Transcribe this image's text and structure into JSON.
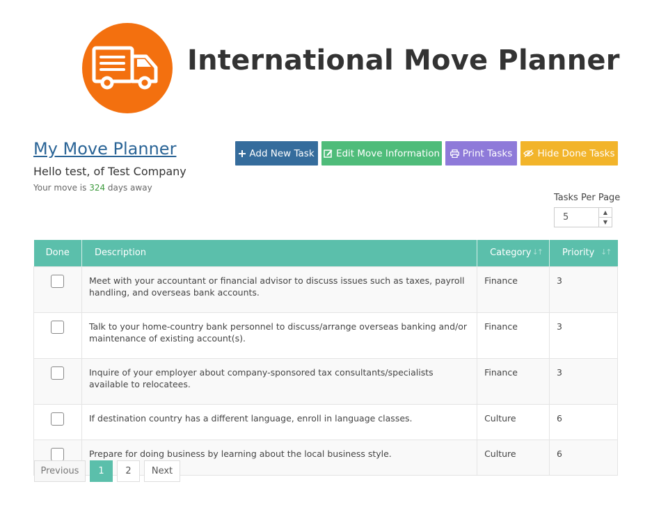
{
  "header": {
    "logo_icon": "truck-icon",
    "logo_color": "#f3700f",
    "title": "International Move Planner"
  },
  "planner": {
    "title": "My Move Planner",
    "greeting": "Hello test, of Test Company",
    "countdown_prefix": "Your move is",
    "days": "324",
    "countdown_suffix": "days away"
  },
  "toolbar": {
    "add_label": "Add New Task",
    "edit_label": "Edit Move Information",
    "print_label": "Print Tasks",
    "hide_label": "Hide Done Tasks",
    "colors": {
      "add": "#356c9c",
      "edit": "#4fbc7a",
      "print": "#8e7ad9",
      "hide": "#f2b42a"
    }
  },
  "pagination_settings": {
    "label": "Tasks Per Page",
    "value": "5"
  },
  "table": {
    "header_color": "#5bbfab",
    "columns": [
      "Done",
      "Description",
      "Category",
      "Priority"
    ],
    "rows": [
      {
        "done": false,
        "description": "Meet with your accountant or financial advisor to discuss issues such as taxes, payroll handling, and overseas bank accounts.",
        "category": "Finance",
        "priority": "3"
      },
      {
        "done": false,
        "description": "Talk to your home-country bank personnel to discuss/arrange overseas banking and/or maintenance of existing account(s).",
        "category": "Finance",
        "priority": "3"
      },
      {
        "done": false,
        "description": "Inquire of your employer about company-sponsored tax consultants/specialists available to relocatees.",
        "category": "Finance",
        "priority": "3"
      },
      {
        "done": false,
        "description": "If destination country has a different language, enroll in language classes.",
        "category": "Culture",
        "priority": "6"
      },
      {
        "done": false,
        "description": "Prepare for doing business by learning about the local business style.",
        "category": "Culture",
        "priority": "6"
      }
    ]
  },
  "pager": {
    "previous": "Previous",
    "pages": [
      "1",
      "2"
    ],
    "current": "1",
    "next": "Next"
  }
}
